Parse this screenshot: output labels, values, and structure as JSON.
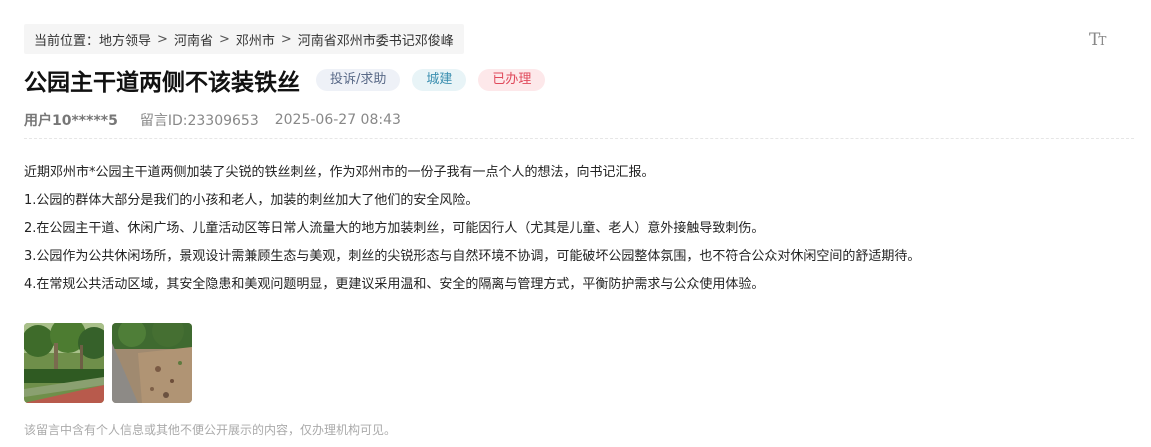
{
  "breadcrumb": {
    "prefix": "当前位置：",
    "items": [
      "地方领导",
      "河南省",
      "邓州市",
      "河南省邓州市委书记邓俊峰"
    ],
    "separator": ">"
  },
  "font_toggle": {
    "icon": "font-size-icon",
    "big": "T",
    "small": "T"
  },
  "post": {
    "title": "公园主干道两侧不该装铁丝",
    "tags": {
      "type": "投诉/求助",
      "area": "城建",
      "status": "已办理"
    },
    "meta": {
      "user": "用户10*****5",
      "message_id": "留言ID:23309653",
      "datetime": "2025-06-27 08:43"
    },
    "paragraphs": [
      "近期邓州市*公园主干道两侧加装了尖锐的铁丝刺丝，作为邓州市的一份子我有一点个人的想法，向书记汇报。",
      "1.公园的群体大部分是我们的小孩和老人，加装的刺丝加大了他们的安全风险。",
      "2.在公园主干道、休闲广场、儿童活动区等日常人流量大的地方加装刺丝，可能因行人（尤其是儿童、老人）意外接触导致刺伤。",
      "3.公园作为公共休闲场所，景观设计需兼顾生态与美观，刺丝的尖锐形态与自然环境不协调，可能破坏公园整体氛围，也不符合公众对休闲空间的舒适期待。",
      "4.在常规公共活动区域，其安全隐患和美观问题明显，更建议采用温和、安全的隔离与管理方式，平衡防护需求与公众使用体验。"
    ],
    "images": [
      "park-photo-1",
      "park-photo-2"
    ],
    "notice": "该留言中含有个人信息或其他不便公开展示的内容，仅办理机构可见。"
  },
  "colors": {
    "status_tag": "#e0495b",
    "type_tag": "#5a6a88",
    "area_tag": "#3b8fb0"
  }
}
